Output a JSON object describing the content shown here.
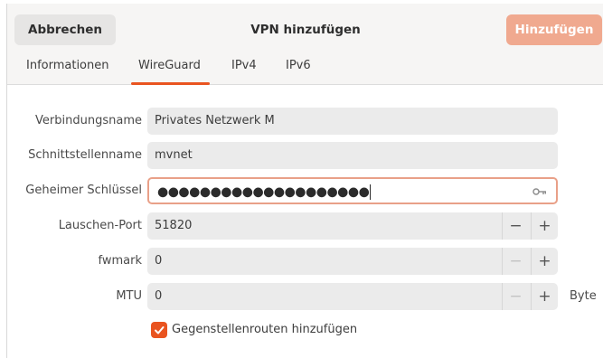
{
  "header": {
    "cancel_label": "Abbrechen",
    "title": "VPN hinzufügen",
    "add_label": "Hinzufügen"
  },
  "tabs": [
    {
      "label": "Informationen",
      "active": false
    },
    {
      "label": "WireGuard",
      "active": true
    },
    {
      "label": "IPv4",
      "active": false
    },
    {
      "label": "IPv6",
      "active": false
    }
  ],
  "form": {
    "connection_name": {
      "label": "Verbindungsname",
      "value": "Privates Netzwerk M"
    },
    "interface_name": {
      "label": "Schnittstellenname",
      "value": "mvnet"
    },
    "secret_key": {
      "label": "Geheimer Schlüssel",
      "masked_value": "●●●●●●●●●●●●●●●●●●●●",
      "icon": "key-icon"
    },
    "listen_port": {
      "label": "Lauschen-Port",
      "value": "51820",
      "minus": "−",
      "plus": "+"
    },
    "fwmark": {
      "label": "fwmark",
      "value": "0",
      "minus": "−",
      "plus": "+"
    },
    "mtu": {
      "label": "MTU",
      "value": "0",
      "minus": "−",
      "plus": "+",
      "unit": "Byte"
    },
    "peer_routes": {
      "label": "Gegenstellenrouten hinzufügen",
      "checked": true
    }
  },
  "colors": {
    "accent": "#e95420",
    "add_button_disabled": "#f0a98f",
    "field_bg": "#ebebeb",
    "header_bg": "#f6f5f4"
  }
}
